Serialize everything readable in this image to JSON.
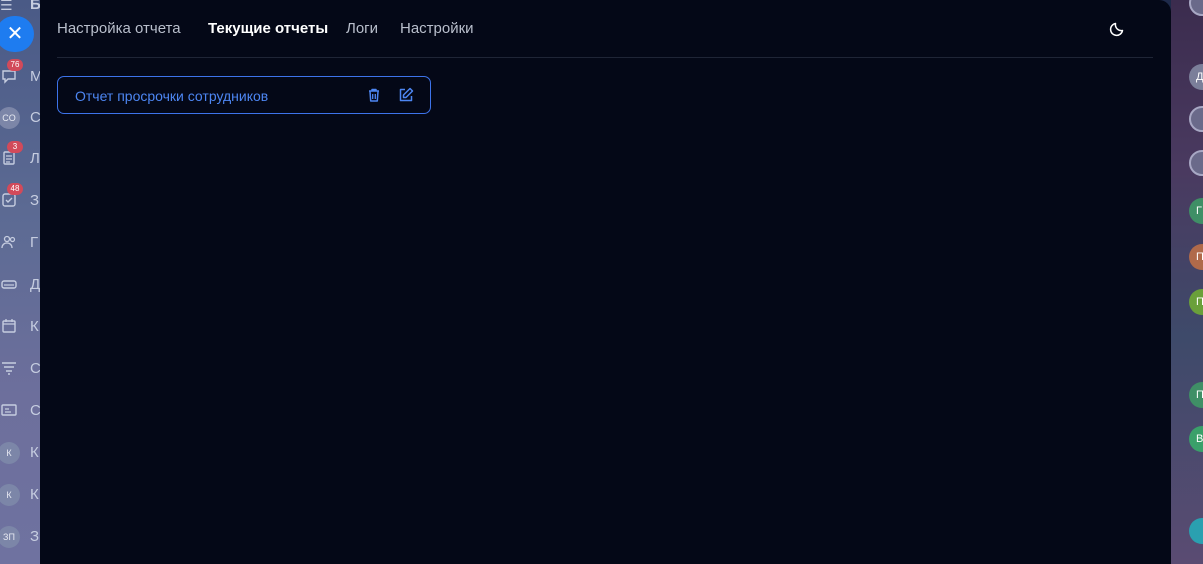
{
  "background_left": {
    "top_text": "Б",
    "items": [
      {
        "icon": "chat-icon",
        "text": "М",
        "badge": "76"
      },
      {
        "icon": "avatar-co",
        "circle": "CO",
        "text": "С"
      },
      {
        "icon": "document-icon",
        "text": "Л",
        "badge": "3"
      },
      {
        "icon": "checkbox-icon",
        "text": "З",
        "badge": "48"
      },
      {
        "icon": "group-icon",
        "text": "Г"
      },
      {
        "icon": "drive-icon",
        "text": "Д"
      },
      {
        "icon": "calendar-icon",
        "text": "К"
      },
      {
        "icon": "funnel-icon",
        "text": "С"
      },
      {
        "icon": "card-icon",
        "text": "С"
      },
      {
        "icon": "avatar-k",
        "circle": "К",
        "text": "К"
      },
      {
        "icon": "avatar-k",
        "circle": "К",
        "text": "К"
      },
      {
        "icon": "avatar-zp",
        "circle": "ЗП",
        "text": "З"
      }
    ]
  },
  "background_right": {
    "avatars": [
      {
        "letter": "Д",
        "color": "#7b7f9a"
      },
      {
        "letter": "",
        "color": "#6a6a8a"
      },
      {
        "letter": "",
        "color": "#6a6a8a"
      },
      {
        "letter": "Г",
        "color": "#3f8f66"
      },
      {
        "letter": "П",
        "color": "#b06a4a"
      },
      {
        "letter": "П",
        "color": "#6aa03a"
      },
      {
        "letter": "П",
        "color": "#3f8f66"
      },
      {
        "letter": "В",
        "color": "#3aa06a"
      },
      {
        "letter": "",
        "color": "#2aa0b0"
      }
    ]
  },
  "close_button": {
    "icon": "close-icon",
    "glyph": "✕"
  },
  "nav": {
    "tabs": [
      {
        "label": "Настройка отчета",
        "active": false
      },
      {
        "label": "Текущие отчеты",
        "active": true
      },
      {
        "label": "Логи",
        "active": false
      },
      {
        "label": "Настройки",
        "active": false
      }
    ],
    "theme_toggle_icon": "moon-icon"
  },
  "reports": [
    {
      "name": "Отчет просрочки сотрудников",
      "delete_icon": "trash-icon",
      "edit_icon": "edit-icon"
    }
  ],
  "colors": {
    "panel_bg": "#040817",
    "accent": "#3d73ea",
    "accent_text": "#4d86f2",
    "close_button": "#1e7cf0"
  }
}
